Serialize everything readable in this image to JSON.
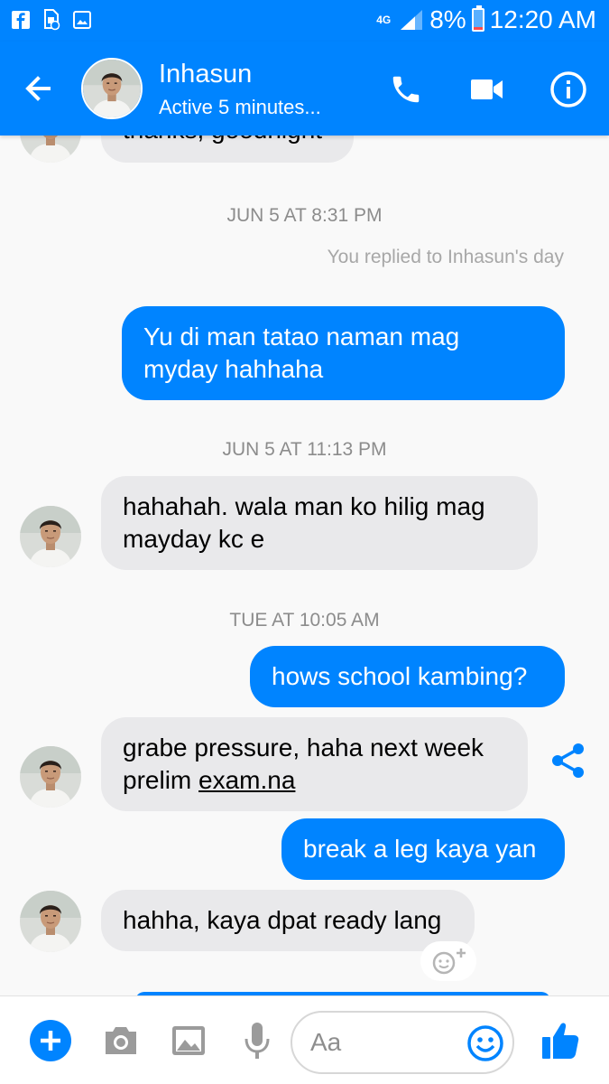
{
  "status_bar": {
    "network": "4G",
    "battery_percent": "8%",
    "time": "12:20 AM",
    "left_icons": [
      "facebook-icon",
      "sim-security-icon",
      "gallery-icon"
    ]
  },
  "header": {
    "contact_name": "Inhasun",
    "contact_status": "Active 5 minutes...",
    "icons": [
      "back-arrow-icon",
      "phone-icon",
      "video-camera-icon",
      "info-icon"
    ]
  },
  "chat": {
    "messages": [
      {
        "type": "incoming",
        "text": "thanks, goodnight"
      },
      {
        "type": "timestamp",
        "text": "JUN 5 AT 8:31 PM"
      },
      {
        "type": "note",
        "text": "You replied to Inhasun's day"
      },
      {
        "type": "outgoing",
        "lines": [
          "Yu di man tatao naman mag",
          "myday hahhaha"
        ]
      },
      {
        "type": "timestamp",
        "text": "JUN 5 AT 11:13 PM"
      },
      {
        "type": "incoming",
        "lines": [
          "hahahah. wala man ko hilig mag",
          "mayday kc e"
        ]
      },
      {
        "type": "timestamp",
        "text": "TUE AT 10:05 AM"
      },
      {
        "type": "outgoing",
        "text": "hows school kambing?"
      },
      {
        "type": "incoming",
        "line1": "grabe pressure, haha next week",
        "line2_prefix": "prelim ",
        "link": "exam.na"
      },
      {
        "type": "outgoing",
        "text": "break a leg kaya yan"
      },
      {
        "type": "incoming",
        "text": "hahha, kaya dpat ready lang"
      }
    ]
  },
  "composer": {
    "placeholder": "Aa",
    "icons": [
      "plus-icon",
      "camera-icon",
      "image-icon",
      "microphone-icon",
      "emoji-icon",
      "thumbs-up-icon"
    ]
  },
  "colors": {
    "accent": "#0084ff",
    "incoming_bubble": "#e9e9eb",
    "timestamp": "#8c8c8c"
  }
}
